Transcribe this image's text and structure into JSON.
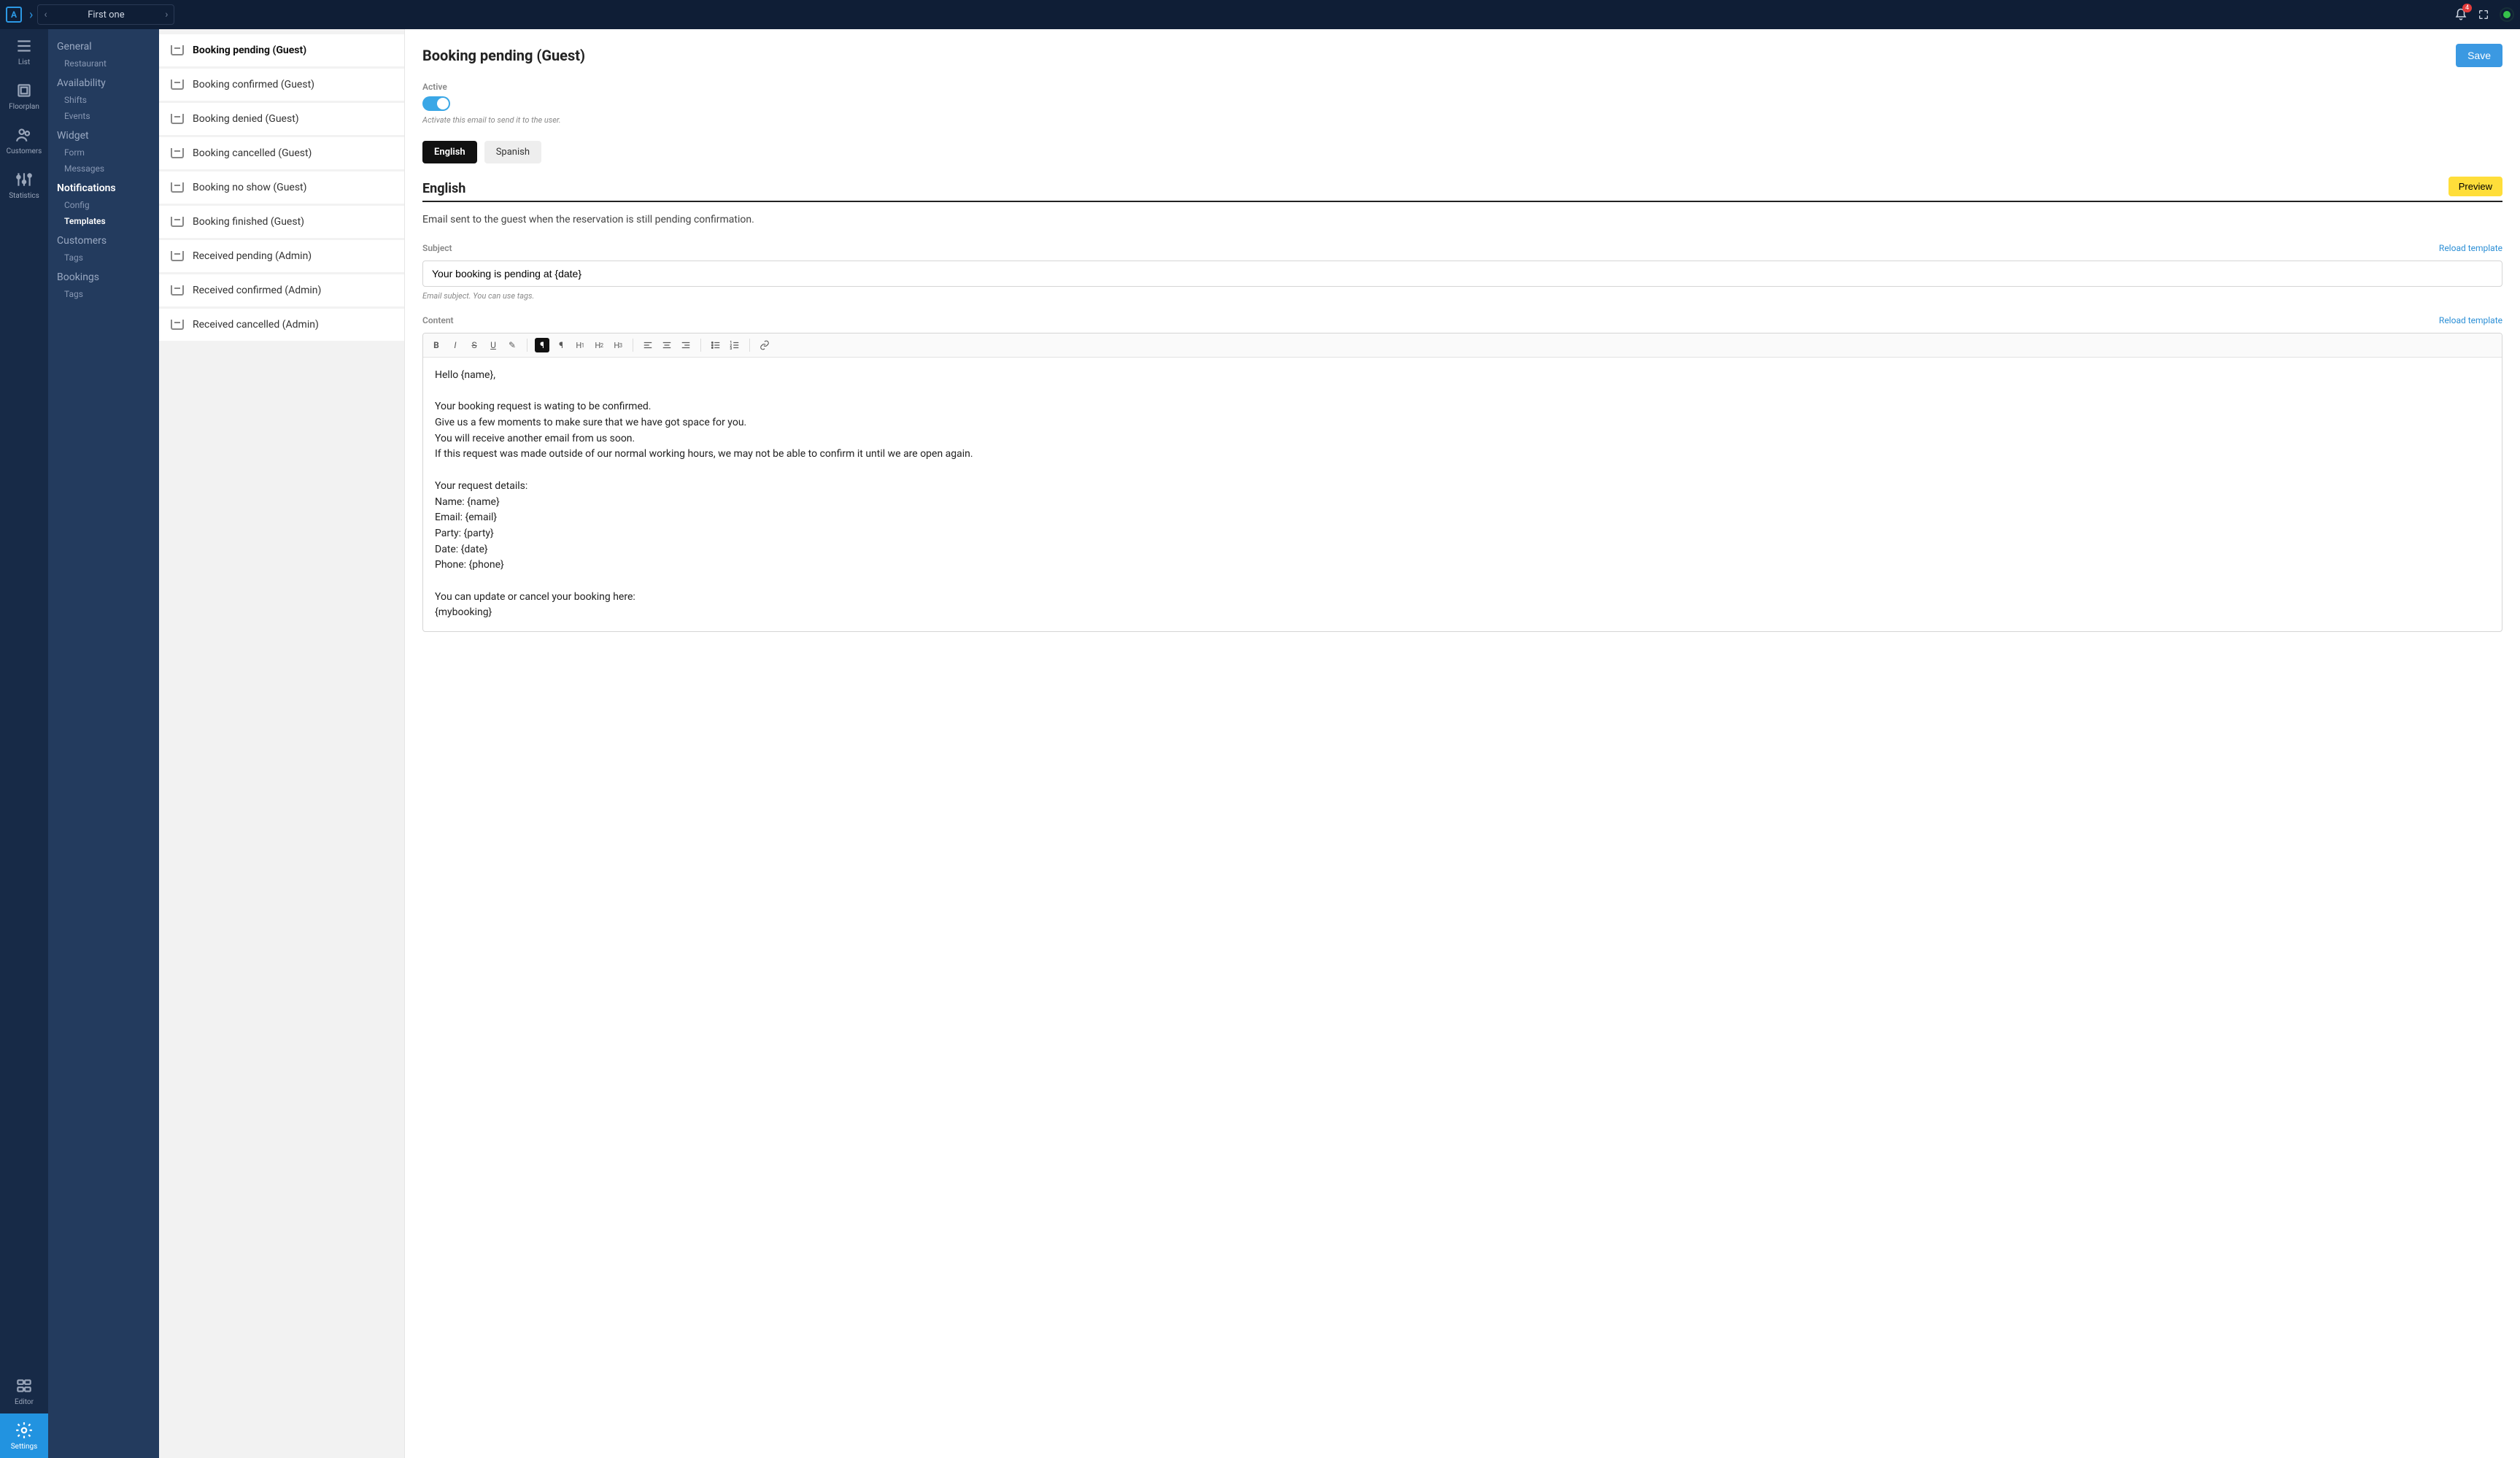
{
  "topbar": {
    "logo_text": "A",
    "breadcrumb_label": "First one",
    "notification_count": "4"
  },
  "rail": {
    "items": [
      {
        "id": "list",
        "label": "List"
      },
      {
        "id": "floorplan",
        "label": "Floorplan"
      },
      {
        "id": "customers",
        "label": "Customers"
      },
      {
        "id": "statistics",
        "label": "Statistics"
      }
    ],
    "bottom": [
      {
        "id": "editor",
        "label": "Editor"
      },
      {
        "id": "settings",
        "label": "Settings",
        "active": true
      }
    ]
  },
  "settings_nav": [
    {
      "label": "General",
      "subs": [
        "Restaurant"
      ]
    },
    {
      "label": "Availability",
      "subs": [
        "Shifts",
        "Events"
      ]
    },
    {
      "label": "Widget",
      "subs": [
        "Form",
        "Messages"
      ]
    },
    {
      "label": "Notifications",
      "active": true,
      "subs": [
        "Config",
        "Templates"
      ],
      "active_sub_index": 1
    },
    {
      "label": "Customers",
      "subs": [
        "Tags"
      ]
    },
    {
      "label": "Bookings",
      "subs": [
        "Tags"
      ]
    }
  ],
  "templates": [
    "Booking pending (Guest)",
    "Booking confirmed (Guest)",
    "Booking denied (Guest)",
    "Booking cancelled (Guest)",
    "Booking no show (Guest)",
    "Booking finished (Guest)",
    "Received pending (Admin)",
    "Received confirmed (Admin)",
    "Received cancelled (Admin)"
  ],
  "selected_template_index": 0,
  "main": {
    "title": "Booking pending (Guest)",
    "save_label": "Save",
    "active_label": "Active",
    "active_hint": "Activate this email to send it to the user.",
    "languages": [
      "English",
      "Spanish"
    ],
    "active_language_index": 0,
    "lang_heading": "English",
    "preview_label": "Preview",
    "description": "Email sent to the guest when the reservation is still pending confirmation.",
    "subject_label": "Subject",
    "reload_label": "Reload template",
    "subject_value": "Your booking is pending at {date}",
    "subject_hint": "Email subject. You can use tags.",
    "content_label": "Content",
    "content_body": "Hello {name},\n\nYour booking request is wating to be confirmed.\nGive us a few moments to make sure that we have got space for you.\nYou will receive another email from us soon.\nIf this request was made outside of our normal working hours, we may not be able to confirm it until we are open again.\n\nYour request details:\nName: {name}\nEmail: {email}\nParty: {party}\nDate: {date}\nPhone: {phone}\n\nYou can update or cancel your booking here:\n{mybooking}"
  },
  "toolbar_buttons": {
    "bold": "B",
    "italic": "I",
    "strike": "S",
    "underline": "U",
    "highlight": "✎",
    "paragraph": "¶",
    "paragraph2": "¶",
    "h1": "H1",
    "h2": "H2",
    "h3": "H3",
    "bullet": "•",
    "ordered": "1.",
    "link": "🔗"
  }
}
